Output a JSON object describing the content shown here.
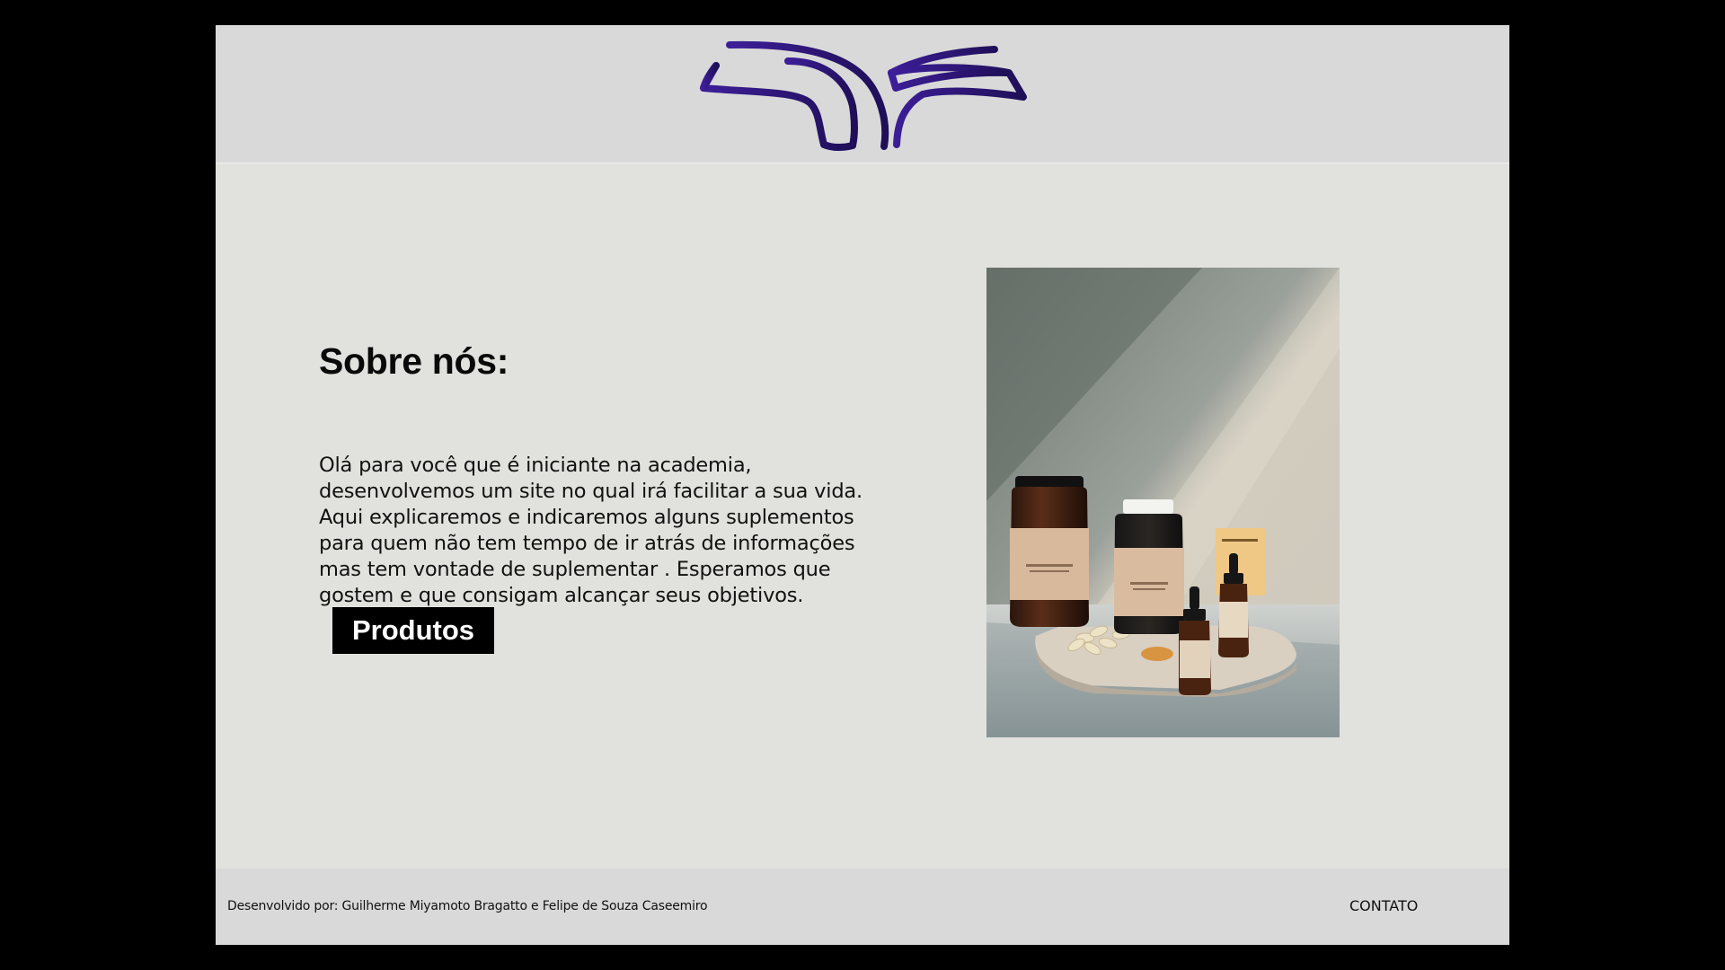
{
  "header": {
    "logo_icon": "open-book-logo-icon",
    "logo_colors": [
      "#3a1a8c",
      "#1e0e52"
    ]
  },
  "about": {
    "title": "Sobre nós:",
    "text": "Olá para você que é iniciante na academia, desenvolvemos um site no qual irá facilitar a sua vida. Aqui explicaremos e indicaremos alguns suplementos para quem não tem tempo de ir atrás de informações mas tem vontade de suplementar . Esperamos que gostem e que consigam alcançar seus objetivos.",
    "button_label": "Produtos"
  },
  "hero_image": {
    "icon": "supplement-bottles-photo"
  },
  "footer": {
    "credits": "Desenvolvido por: Guilherme Miyamoto Bragatto e Felipe de Souza Caseemiro",
    "contact_label": "CONTATO"
  },
  "colors": {
    "page_background": "#e1e2dd",
    "header_background": "#d9d9d9",
    "footer_background": "#d9d9d9",
    "button_background": "#000000",
    "logo_purple": "#3a1a8c"
  }
}
